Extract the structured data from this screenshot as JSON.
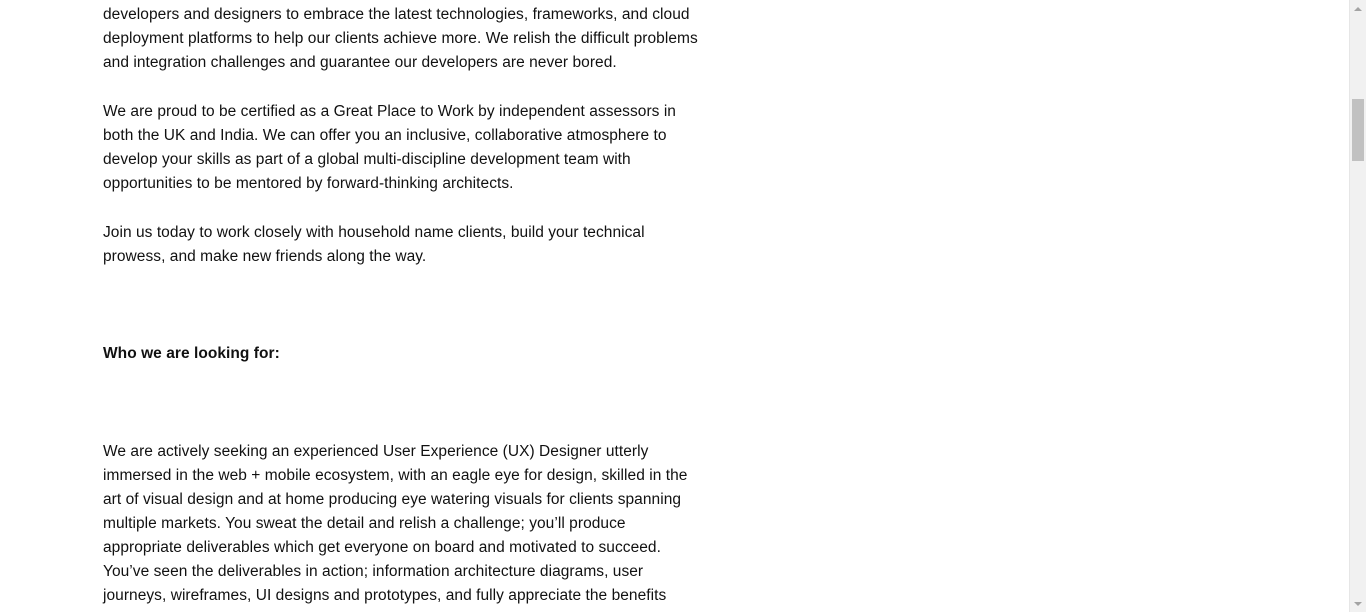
{
  "article": {
    "paragraphs_top": [
      "work primarily with Nonprofit and Public Sector organisations. We encourage all our developers and designers to embrace the latest technologies, frameworks, and cloud deployment platforms to help our clients achieve more. We relish the difficult problems and integration challenges and guarantee our developers are never bored.",
      "We are proud to be certified as a Great Place to Work by independent assessors in both the UK and India. We can offer you an inclusive, collaborative atmosphere to develop your skills as part of a global multi-discipline development team with opportunities to be mentored by forward-thinking architects.",
      "Join us today to work closely with household name clients, build your technical prowess, and make new friends along the way."
    ],
    "heading": "Who we are looking for:",
    "paragraph_bottom": "We are actively seeking an experienced User Experience (UX) Designer utterly immersed in the web + mobile ecosystem, with an eagle eye for design, skilled in the art of visual design and at home producing eye watering visuals for clients spanning multiple markets.  You sweat the detail and relish a challenge; you’ll produce appropriate deliverables which get everyone on board and motivated to succeed. You’ve seen the deliverables in action; information architecture diagrams, user journeys, wireframes, UI designs and prototypes, and fully appreciate the benefits"
  },
  "scrollbar": {
    "up_icon": "chevron-up-icon",
    "down_icon": "chevron-down-icon",
    "position_fraction": 0.16
  }
}
